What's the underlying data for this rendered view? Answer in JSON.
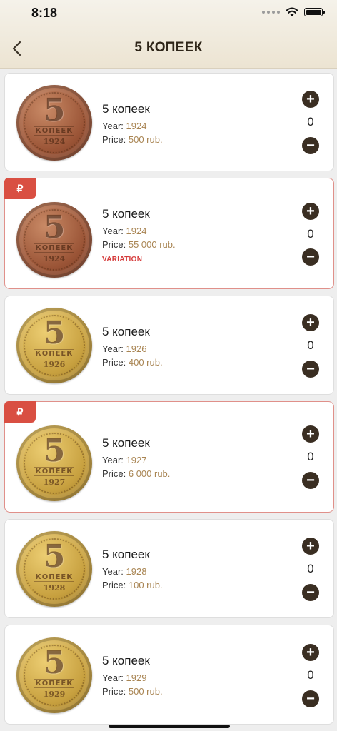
{
  "status": {
    "time": "8:18"
  },
  "header": {
    "title": "5 КОПЕЕК"
  },
  "items": [
    {
      "name": "5 копеек",
      "year_label": "Year:",
      "year": "1924",
      "price_label": "Price:",
      "price": "500 rub.",
      "qty": "0",
      "metal": "copper",
      "coin_year": "1924",
      "rare": false,
      "badge": "",
      "variation": ""
    },
    {
      "name": "5 копеек",
      "year_label": "Year:",
      "year": "1924",
      "price_label": "Price:",
      "price": "55 000 rub.",
      "qty": "0",
      "metal": "copper",
      "coin_year": "1924",
      "rare": true,
      "badge": "₽",
      "variation": "VARIATION"
    },
    {
      "name": "5 копеек",
      "year_label": "Year:",
      "year": "1926",
      "price_label": "Price:",
      "price": "400 rub.",
      "qty": "0",
      "metal": "brass",
      "coin_year": "1926",
      "rare": false,
      "badge": "",
      "variation": ""
    },
    {
      "name": "5 копеек",
      "year_label": "Year:",
      "year": "1927",
      "price_label": "Price:",
      "price": "6 000 rub.",
      "qty": "0",
      "metal": "brass",
      "coin_year": "1927",
      "rare": true,
      "badge": "₽",
      "variation": ""
    },
    {
      "name": "5 копеек",
      "year_label": "Year:",
      "year": "1928",
      "price_label": "Price:",
      "price": "100 rub.",
      "qty": "0",
      "metal": "brass",
      "coin_year": "1928",
      "rare": false,
      "badge": "",
      "variation": ""
    },
    {
      "name": "5 копеек",
      "year_label": "Year:",
      "year": "1929",
      "price_label": "Price:",
      "price": "500 rub.",
      "qty": "0",
      "metal": "brass",
      "coin_year": "1929",
      "rare": false,
      "badge": "",
      "variation": ""
    }
  ],
  "coin_art": {
    "denomination": "5",
    "word": "КОПЕЕК"
  },
  "colors": {
    "accent_brown": "#3a2e22",
    "price_gold": "#a98553",
    "rare_red": "#d94f42",
    "variation_red": "#d63c3c"
  },
  "icons": {
    "back": "chevron-left-icon",
    "plus": "plus-circle-icon",
    "minus": "minus-circle-icon",
    "wifi": "wifi-icon",
    "battery": "battery-icon",
    "signal": "signal-icon",
    "rare": "ruble-badge-icon"
  }
}
